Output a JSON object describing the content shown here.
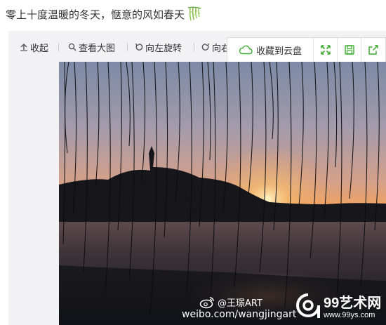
{
  "post": {
    "text": "零上十度温暖的冬天，惬意的风如春天",
    "emoji": "willow-emoji"
  },
  "toolbar": {
    "collapse_label": "收起",
    "view_large_label": "查看大图",
    "rotate_left_label": "向左旋转",
    "rotate_right_label": "向右"
  },
  "floating_actions": {
    "cloud_save_label": "收藏到云盘",
    "fullscreen_icon": "expand-icon",
    "save_icon": "floppy-disk-icon",
    "share_icon": "share-icon",
    "accent_color": "#3bab2e"
  },
  "image": {
    "weibo_handle": "@王璟ART",
    "weibo_url": "weibo.com/wangjingart",
    "site_brand": "99艺术网",
    "site_url": "www.99ys.com"
  }
}
